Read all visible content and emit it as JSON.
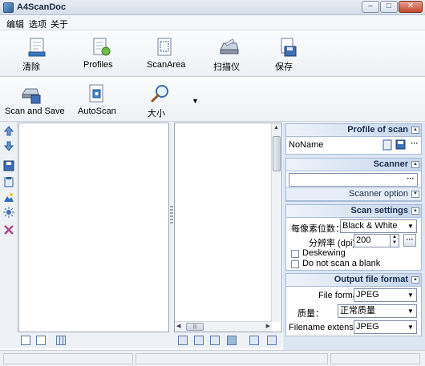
{
  "window": {
    "title": "A4ScanDoc",
    "min": "–",
    "max": "□",
    "close": "✕"
  },
  "menu": [
    "编辑",
    "选项",
    "关于"
  ],
  "toolbar1": [
    "清除",
    "Profiles",
    "ScanArea",
    "扫描仪",
    "保存"
  ],
  "toolbar2": [
    "Scan and Save",
    "AutoScan",
    "大小"
  ],
  "toolbar2_dropdown": "▼",
  "icons": {
    "clear": "clear-icon",
    "profiles": "profiles-icon",
    "scanarea": "scan-area-icon",
    "scanner": "scanner-icon",
    "save": "save-icon",
    "scan_and_save": "scan-and-save-icon",
    "autoscan": "autoscan-icon",
    "zoom": "magnifier-icon"
  },
  "colors": {
    "accent": "#2c5f9e",
    "pane_bg": "#dce6f3",
    "header_text": "#1b2e4d"
  },
  "profile": {
    "header": "Profile of scan",
    "name": "NoName",
    "dots": "···"
  },
  "scanner": {
    "header": "Scanner",
    "value": "",
    "option_label": "Scanner option",
    "dots": "···"
  },
  "scan_settings": {
    "header": "Scan settings",
    "bits_label": "每像素位数：",
    "bits_value": "Black & White",
    "dpi_label": "分辨率 (dpi):",
    "dpi_value": "200",
    "deskew": "Deskewing",
    "skip_blank": "Do not scan a blank",
    "dots": "···"
  },
  "output": {
    "header": "Output file format",
    "format_label": "File format",
    "format_value": "JPEG",
    "quality_label": "质量：",
    "quality_value": "正常质量",
    "ext_label": "Filename extension:",
    "ext_value": "JPEG"
  }
}
